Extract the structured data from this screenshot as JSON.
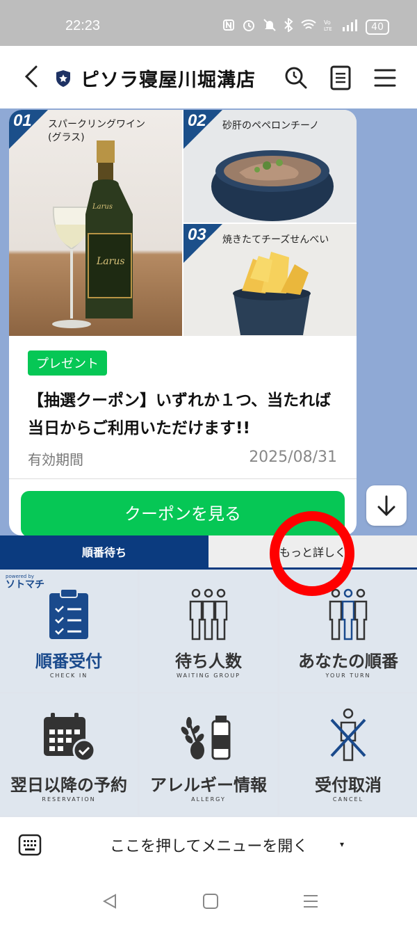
{
  "status_bar": {
    "time": "22:23",
    "battery": "40"
  },
  "header": {
    "title": "ピソラ寝屋川堀溝店"
  },
  "coupon": {
    "items": [
      {
        "number": "01",
        "name": "スパークリングワイン\n(グラス)"
      },
      {
        "number": "02",
        "name": "砂肝のペペロンチーノ"
      },
      {
        "number": "03",
        "name": "焼きたてチーズせんべい"
      }
    ],
    "bottle_brand": "Larus",
    "tag": "プレゼント",
    "title": "【抽選クーポン】いずれか１つ、当たれば当日からご利用いただけます!!",
    "validity_label": "有効期間",
    "validity_date": "2025/08/31",
    "view_button": "クーポンを見る"
  },
  "rich_menu": {
    "tabs": [
      {
        "label": "順番待ち",
        "active": true
      },
      {
        "label": "もっと詳しく",
        "active": false
      }
    ],
    "powered_by": "powered by",
    "powered_brand": "ソトマチ",
    "cells": [
      {
        "label": "順番受付",
        "sub": "CHECK IN",
        "icon": "clipboard-checklist-icon"
      },
      {
        "label": "待ち人数",
        "sub": "WAITING GROUP",
        "icon": "people-group-icon"
      },
      {
        "label": "あなたの順番",
        "sub": "YOUR TURN",
        "icon": "your-turn-people-icon"
      },
      {
        "label": "翌日以降の予約",
        "sub": "RESERVATION",
        "icon": "calendar-check-icon"
      },
      {
        "label": "アレルギー情報",
        "sub": "ALLERGY",
        "icon": "wheat-milk-egg-icon"
      },
      {
        "label": "受付取消",
        "sub": "CANCEL",
        "icon": "person-cross-icon"
      }
    ]
  },
  "menu_bar": {
    "text": "ここを押してメニューを開く",
    "caret": "▾"
  },
  "colors": {
    "line_green": "#06c755",
    "navy": "#0b3b7f",
    "chat_bg": "#8fa9d5",
    "highlight_red": "#ff0000"
  }
}
